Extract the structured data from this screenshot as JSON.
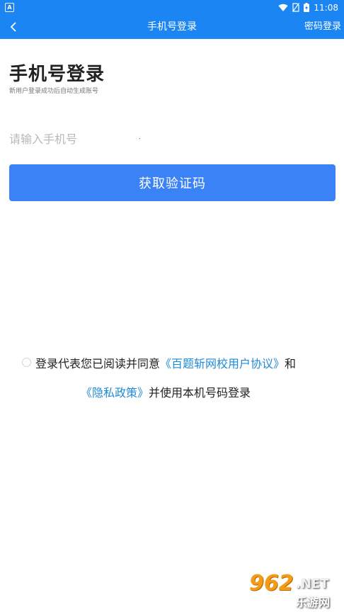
{
  "status_bar": {
    "app_icon_letter": "A",
    "time": "11:08"
  },
  "app_bar": {
    "title": "手机号登录",
    "password_login": "密码登录"
  },
  "page": {
    "title": "手机号登录",
    "subtitle": "新用户登录成功后自动生成账号"
  },
  "phone_input": {
    "placeholder": "请输入手机号",
    "value": ""
  },
  "get_code_button": "获取验证码",
  "agreement": {
    "prefix": "登录代表您已阅读并同意",
    "user_agreement_link": "《百题斩网校用户协议》",
    "and": "和",
    "privacy_link": "《隐私政策》",
    "suffix": "并使用本机号码登录",
    "checked": false
  },
  "watermark": {
    "number": "962",
    "net": ".NET",
    "cn": "乐游网"
  },
  "colors": {
    "header": "#1a85f3",
    "button": "#3a82f6",
    "link": "#1f8ad6"
  }
}
